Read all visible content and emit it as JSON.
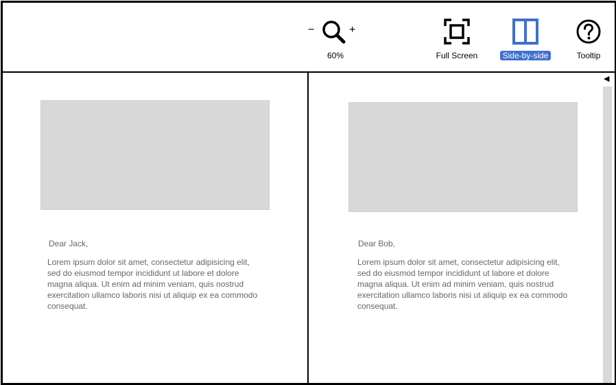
{
  "toolbar": {
    "zoom": {
      "minus": "−",
      "plus": "+",
      "level": "60%"
    },
    "full_screen_label": "Full Screen",
    "side_by_side_label": "Side-by-side",
    "tooltip_label": "Tooltip",
    "accent_color": "#3f6fd0"
  },
  "panes": [
    {
      "greeting": "Dear Jack,",
      "body": "Lorem ipsum dolor sit amet, consectetur adipisicing elit, sed do eiusmod tempor incididunt ut labore et dolore magna aliqua. Ut enim ad minim veniam, quis nostrud exercitation ullamco laboris nisi ut aliquip ex ea commodo consequat."
    },
    {
      "greeting": "Dear Bob,",
      "body": "Lorem ipsum dolor sit amet, consectetur adipisicing elit, sed do eiusmod tempor incididunt ut labore et dolore magna aliqua. Ut enim ad minim veniam, quis nostrud exercitation ullamco laboris nisi ut aliquip ex ea commodo consequat."
    }
  ],
  "scrollbar": {
    "arrow": "◀"
  }
}
